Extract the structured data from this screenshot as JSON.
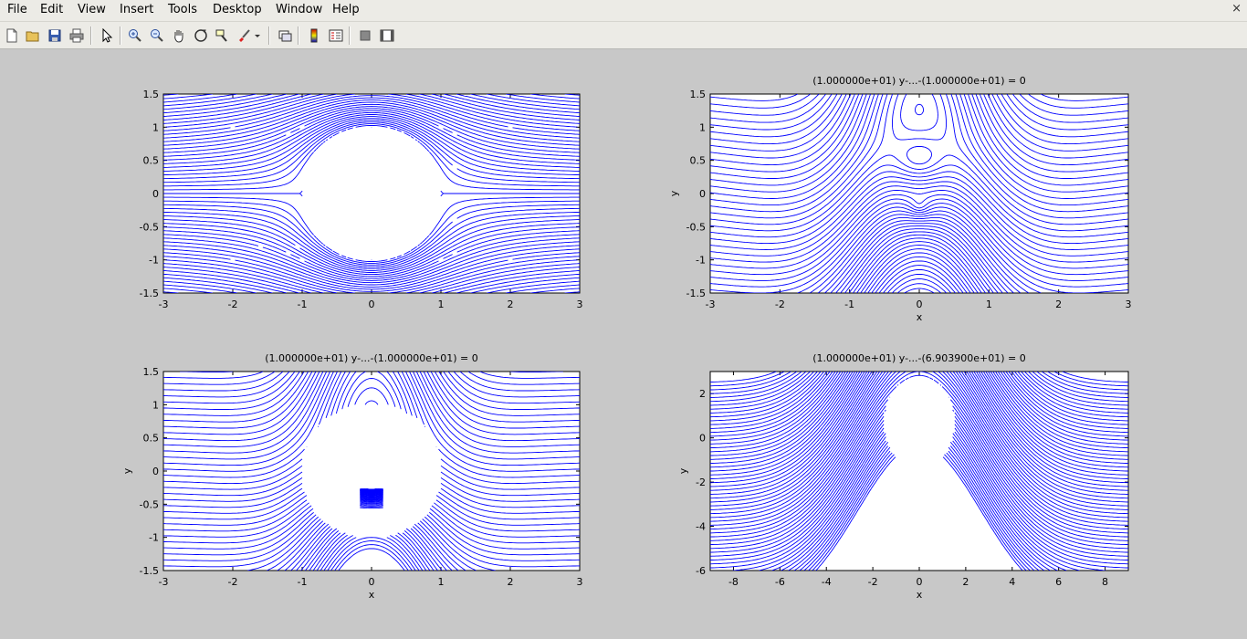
{
  "menubar": {
    "items": [
      "File",
      "Edit",
      "View",
      "Insert",
      "Tools",
      "Desktop",
      "Window",
      "Help"
    ],
    "close_glyph": "×"
  },
  "toolbar": {
    "buttons": [
      "new-figure-icon",
      "open-file-icon",
      "save-icon",
      "print-icon",
      "edit-plot-arrow-icon",
      "zoom-in-icon",
      "zoom-out-icon",
      "pan-hand-icon",
      "rotate-3d-icon",
      "data-cursor-icon",
      "brush-icon",
      "brush-dropdown-icon",
      "link-plot-icon",
      "insert-colorbar-icon",
      "insert-legend-icon",
      "hide-plot-tools-icon",
      "show-plot-tools-icon"
    ]
  },
  "chart_data": [
    {
      "type": "line",
      "title": "",
      "xlabel": "",
      "ylabel": "",
      "xlim": [
        -3,
        3
      ],
      "ylim": [
        -1.5,
        1.5
      ],
      "xticks": [
        "-3",
        "-2",
        "-1",
        "0",
        "1",
        "2",
        "3"
      ],
      "yticks": [
        "1.5",
        "1",
        "0.5",
        "0",
        "-0.5",
        "-1",
        "-1.5"
      ],
      "line_color": "#0000ff",
      "description": "streamlines around circle of radius 1"
    },
    {
      "type": "line",
      "title": "(1.000000e+01) y-...-(1.000000e+01) = 0",
      "xlabel": "x",
      "ylabel": "y",
      "xlim": [
        -3,
        3
      ],
      "ylim": [
        -1.5,
        1.5
      ],
      "xticks": [
        "-3",
        "-2",
        "-1",
        "0",
        "1",
        "2",
        "3"
      ],
      "yticks": [
        "1.5",
        "1",
        "0.5",
        "0",
        "-0.5",
        "-1",
        "-1.5"
      ],
      "line_color": "#0000ff"
    },
    {
      "type": "line",
      "title": "(1.000000e+01) y-...-(1.000000e+01) = 0",
      "xlabel": "x",
      "ylabel": "y",
      "xlim": [
        -3,
        3
      ],
      "ylim": [
        -1.5,
        1.5
      ],
      "xticks": [
        "-3",
        "-2",
        "-1",
        "0",
        "1",
        "2",
        "3"
      ],
      "yticks": [
        "1.5",
        "1",
        "0.5",
        "0",
        "-0.5",
        "-1",
        "-1.5"
      ],
      "line_color": "#0000ff"
    },
    {
      "type": "line",
      "title": "(1.000000e+01) y-...-(6.903900e+01) = 0",
      "xlabel": "x",
      "ylabel": "y",
      "xlim": [
        -9,
        9
      ],
      "ylim": [
        -6,
        3
      ],
      "xticks": [
        "-8",
        "-6",
        "-4",
        "-2",
        "0",
        "2",
        "4",
        "6",
        "8"
      ],
      "yticks": [
        "2",
        "0",
        "-2",
        "-4",
        "-6"
      ],
      "line_color": "#0000ff"
    }
  ]
}
